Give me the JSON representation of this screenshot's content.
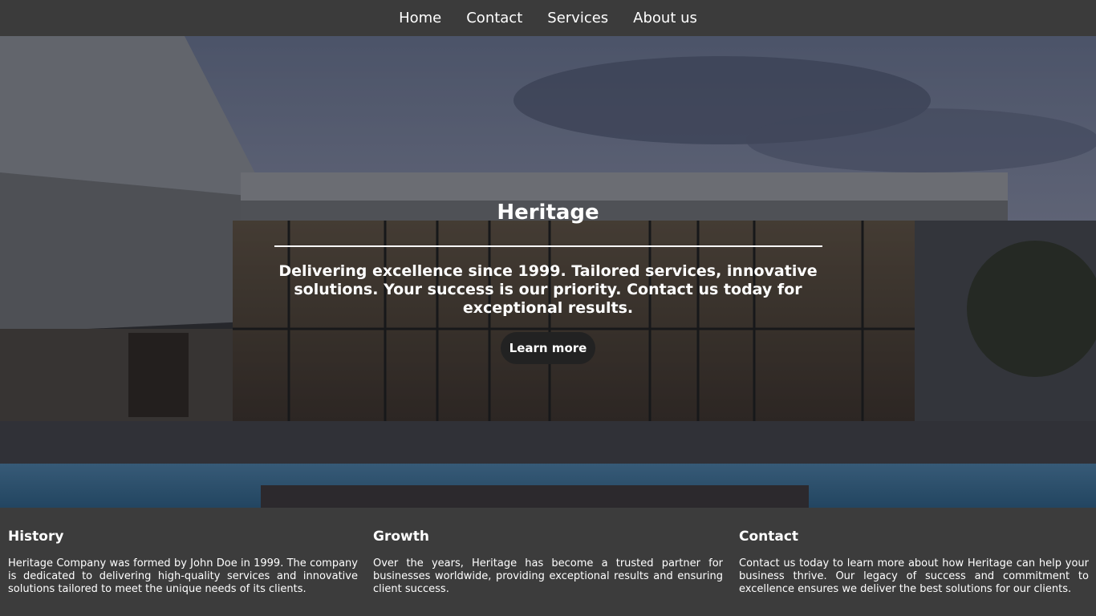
{
  "nav": {
    "items": [
      {
        "label": "Home"
      },
      {
        "label": "Contact"
      },
      {
        "label": "Services"
      },
      {
        "label": "About us"
      }
    ]
  },
  "hero": {
    "title": "Heritage",
    "text": "Delivering excellence since 1999. Tailored services, innovative solutions. Your success is our priority. Contact us today for exceptional results.",
    "button_label": "Learn more"
  },
  "footer": {
    "columns": [
      {
        "heading": "History",
        "text": "Heritage Company was formed by John Doe in 1999. The company is dedicated to delivering high-quality services and innovative solutions tailored to meet the unique needs of its clients."
      },
      {
        "heading": "Growth",
        "text": "Over the years, Heritage has become a trusted partner for businesses worldwide, providing exceptional results and ensuring client success."
      },
      {
        "heading": "Contact",
        "text": "Contact us today to learn more about how Heritage can help your business thrive. Our legacy of success and commitment to excellence ensures we deliver the best solutions for our clients."
      }
    ]
  }
}
